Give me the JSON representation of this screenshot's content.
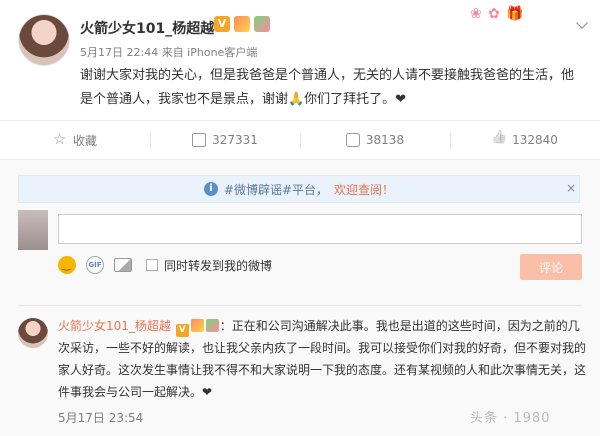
{
  "post": {
    "username": "火箭少女101_杨超越",
    "verified_badge": "V",
    "meta": "5月17日 22:44 来自 iPhone客户端",
    "content": "谢谢大家对我的关心，但是我爸爸是个普通人，无关的人请不要接触我爸爸的生活，他是个普通人，我家也不是景点，谢谢🙏你们了拜托了。❤"
  },
  "actions": {
    "favorite": "收藏",
    "share": "327331",
    "comment": "38138",
    "like": "132840"
  },
  "comment_box": {
    "notice_prefix": "#微博辟谣#平台，",
    "notice_link": "欢迎查阅！",
    "notice_close": "×",
    "gif_label": "GIF",
    "forward_label": "同时转发到我的微博",
    "submit_label": "评论"
  },
  "reply": {
    "name": "火箭少女101_杨超越",
    "verified_badge": "V",
    "text": "：正在和公司沟通解决此事。我也是出道的这些时间，因为之前的几次采访，一些不好的解读，也让我父亲内疚了一段时间。我可以接受你们对我的好奇，但不要对我的家人好奇。这次发生事情让我不得不和大家说明一下我的态度。还有某视频的人和此次事情无关，这件事我会与公司一起解决。❤",
    "time": "5月17日 23:54"
  },
  "colors": {
    "accent": "#eb7350",
    "notice_bg": "#eaf3fb",
    "submit_bg": "#fbbfa8"
  }
}
